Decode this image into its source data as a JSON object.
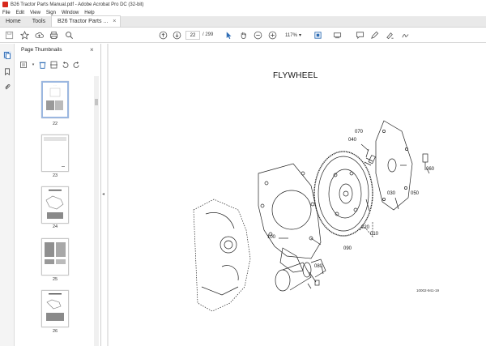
{
  "window": {
    "title": "B26 Tractor Parts Manual.pdf - Adobe Acrobat Pro DC (32-bit)"
  },
  "menu": [
    "File",
    "Edit",
    "View",
    "Sign",
    "Window",
    "Help"
  ],
  "tabs": {
    "home": "Home",
    "tools": "Tools",
    "document": "B26 Tractor Parts ..."
  },
  "toolbar": {
    "current_page": "22",
    "total_pages": "/ 299",
    "zoom": "117%"
  },
  "thumbnail_panel": {
    "title": "Page Thumbnails",
    "pages": [
      "22",
      "23",
      "24",
      "25",
      "26"
    ],
    "selected_page": "22"
  },
  "document": {
    "page_title": "FLYWHEEL",
    "figure_code": "10002-941-19",
    "callouts": [
      "070",
      "040",
      "060",
      "030",
      "050",
      "100",
      "020",
      "010",
      "090",
      "080"
    ]
  }
}
